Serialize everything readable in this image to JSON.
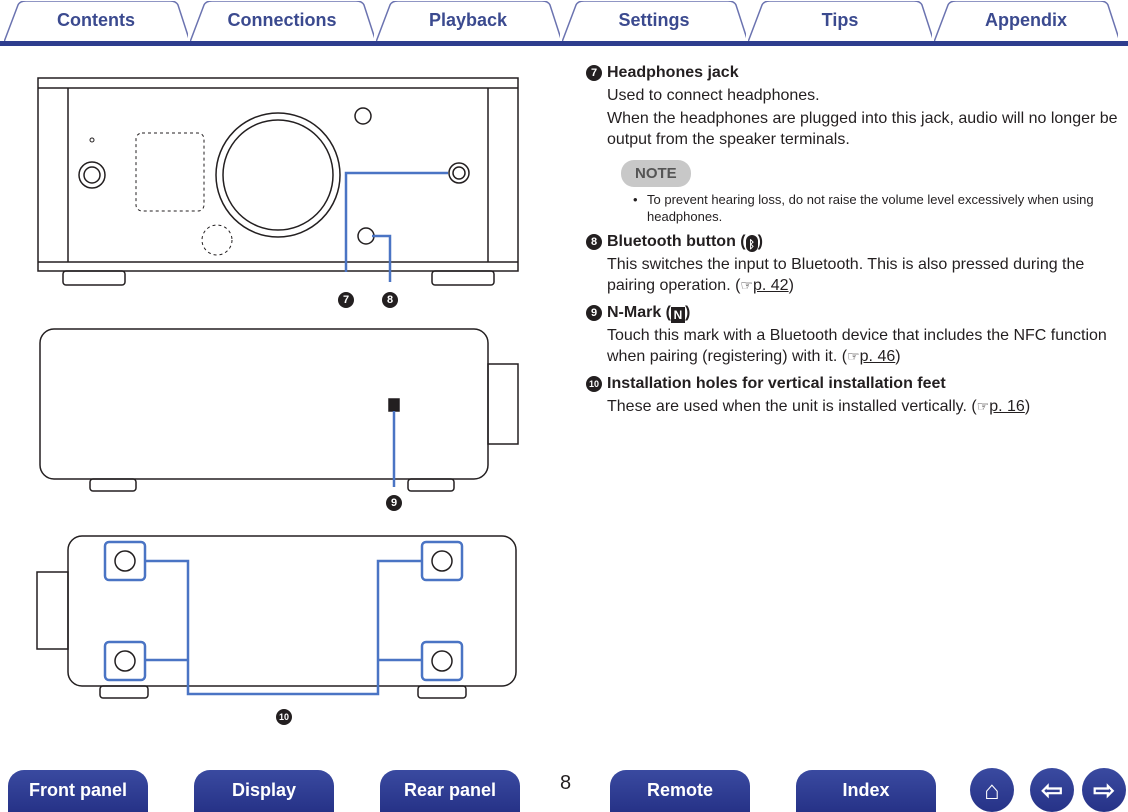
{
  "tabs": [
    "Contents",
    "Connections",
    "Playback",
    "Settings",
    "Tips",
    "Appendix"
  ],
  "callouts": {
    "n7": "7",
    "n8": "8",
    "n9": "9",
    "n10": "10"
  },
  "items": [
    {
      "num": "7",
      "title": "Headphones jack",
      "lines": [
        "Used to connect headphones.",
        "When the headphones are plugged into this jack, audio will no longer be output from the speaker terminals."
      ],
      "note_label": "NOTE",
      "note": "To prevent hearing loss, do not raise the volume level excessively when using headphones."
    },
    {
      "num": "8",
      "title": "Bluetooth button (",
      "title_end": ")",
      "icon": "bluetooth-icon",
      "text": "This switches the input to Bluetooth. This is also pressed during the pairing operation.  (",
      "ref": "p. 42",
      "close": ")"
    },
    {
      "num": "9",
      "title": "N-Mark (",
      "title_end": ")",
      "icon": "n-mark-icon",
      "text": "Touch this mark with a Bluetooth device that includes the NFC function when pairing (registering) with it.  (",
      "ref": "p. 46",
      "close": ")"
    },
    {
      "num": "10",
      "title": "Installation holes for vertical installation feet",
      "text": "These are used when the unit is installed vertically.  (",
      "ref": "p. 16",
      "close": ")"
    }
  ],
  "footer": {
    "buttons": [
      "Front panel",
      "Display",
      "Rear panel",
      "Remote",
      "Index"
    ],
    "page": "8",
    "home": "home-icon",
    "back": "arrow-left-icon",
    "forward": "arrow-right-icon"
  },
  "colors": {
    "accent": "#2e3d8e",
    "callout_line": "#4a74c4"
  }
}
